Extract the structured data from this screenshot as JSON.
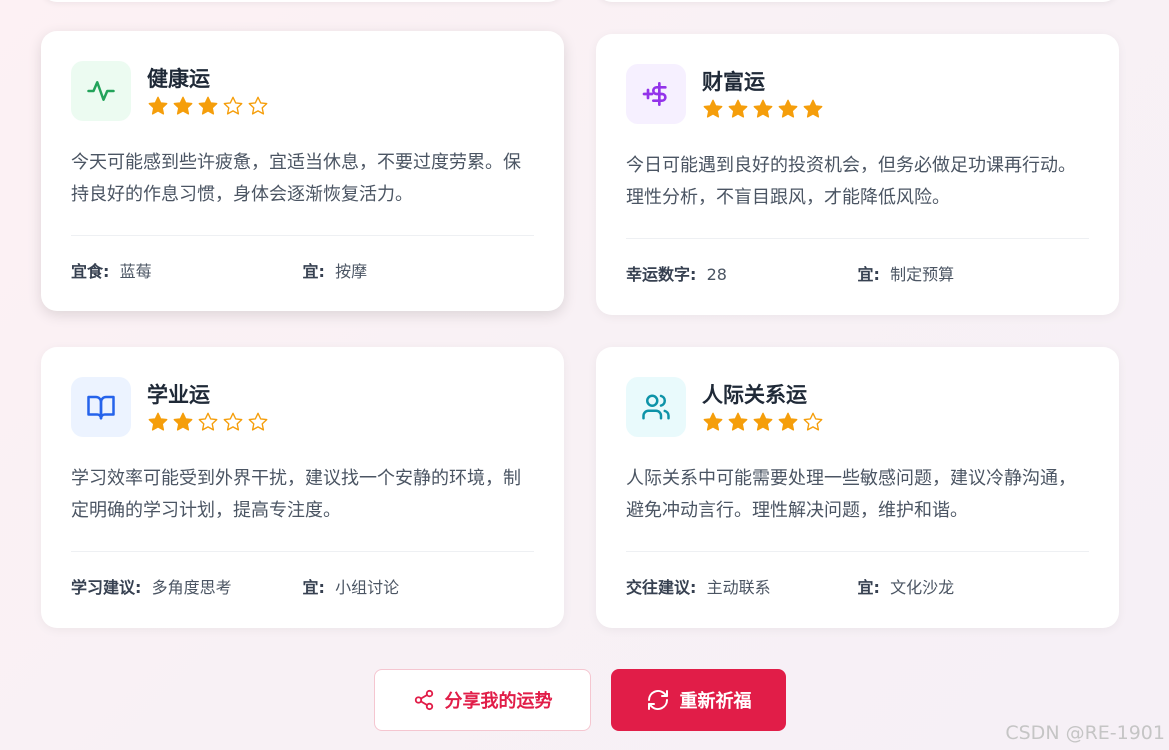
{
  "cards": [
    {
      "title": "健康运",
      "rating": 3,
      "icon": "pulse-icon",
      "accent": "#22a35a",
      "icon_bg": "#ecfbf1",
      "description": "今天可能感到些许疲惫，宜适当休息，不要过度劳累。保持良好的作息习惯，身体会逐渐恢复活力。",
      "meta": [
        {
          "key": "宜食:",
          "value": "蓝莓"
        },
        {
          "key": "宜:",
          "value": "按摩"
        }
      ]
    },
    {
      "title": "财富运",
      "rating": 5,
      "icon": "dollar-icon",
      "accent": "#9333ea",
      "icon_bg": "#f6f0ff",
      "description": "今日可能遇到良好的投资机会，但务必做足功课再行动。理性分析，不盲目跟风，才能降低风险。",
      "meta": [
        {
          "key": "幸运数字:",
          "value": "28"
        },
        {
          "key": "宜:",
          "value": "制定预算"
        }
      ]
    },
    {
      "title": "学业运",
      "rating": 2,
      "icon": "book-icon",
      "accent": "#2563eb",
      "icon_bg": "#ecf3ff",
      "description": "学习效率可能受到外界干扰，建议找一个安静的环境，制定明确的学习计划，提高专注度。",
      "meta": [
        {
          "key": "学习建议:",
          "value": "多角度思考"
        },
        {
          "key": "宜:",
          "value": "小组讨论"
        }
      ]
    },
    {
      "title": "人际关系运",
      "rating": 4,
      "icon": "users-icon",
      "accent": "#0e93a8",
      "icon_bg": "#e9fafc",
      "description": "人际关系中可能需要处理一些敏感问题，建议冷静沟通，避免冲动言行。理性解决问题，维护和谐。",
      "meta": [
        {
          "key": "交往建议:",
          "value": "主动联系"
        },
        {
          "key": "宜:",
          "value": "文化沙龙"
        }
      ]
    }
  ],
  "actions": {
    "share_label": "分享我的运势",
    "share_icon": "share-icon",
    "retry_label": "重新祈福",
    "retry_icon": "refresh-icon"
  },
  "colors": {
    "star": "#f59e0b",
    "primary": "#e11d48"
  },
  "watermark": "CSDN @RE-1901"
}
